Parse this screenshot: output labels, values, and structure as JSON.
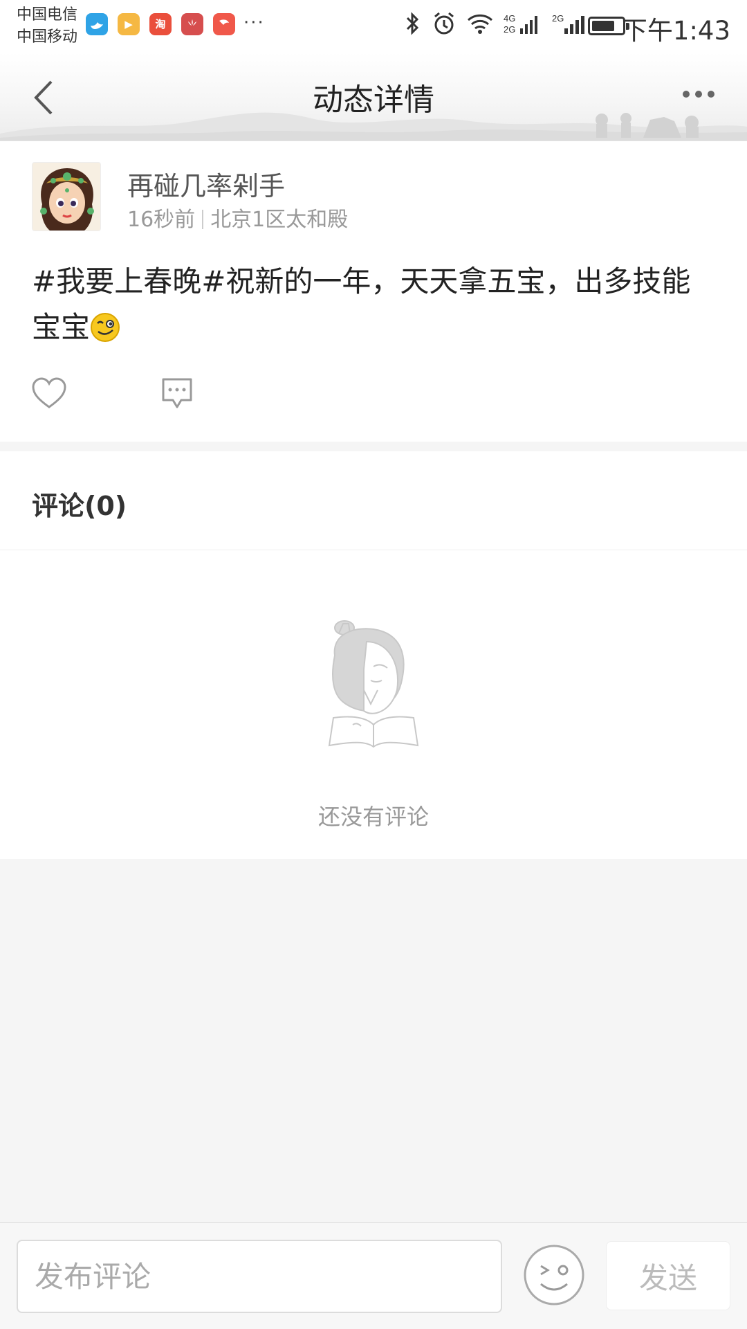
{
  "status_bar": {
    "carrier_1": "中国电信",
    "carrier_2": "中国移动",
    "notification_icons": [
      {
        "name": "bird-app-icon",
        "label": "",
        "color": "#2fa3e6"
      },
      {
        "name": "play-app-icon",
        "label": "▶",
        "color": "#f5b843"
      },
      {
        "name": "taobao-app-icon",
        "label": "淘",
        "color": "#ea4f3c"
      },
      {
        "name": "huawei-app-icon",
        "label": "",
        "color": "#d64e4e"
      },
      {
        "name": "shrimp-app-icon",
        "label": "",
        "color": "#f0584a"
      }
    ],
    "more_indicator": "···",
    "network_1": "4G 2G",
    "network_2": "2G",
    "battery_level": 0.74,
    "time": "下午1:43"
  },
  "header": {
    "title": "动态详情"
  },
  "post": {
    "username": "再碰几率剁手",
    "time_ago": "16秒前",
    "location": "北京1区太和殿",
    "text": "#我要上春晚#祝新的一年，天天拿五宝，出多技能宝宝",
    "emoji": "grinning-wink-emoji"
  },
  "comments": {
    "title": "评论(0)",
    "empty_text": "还没有评论"
  },
  "composer": {
    "placeholder": "发布评论",
    "value": "",
    "send_label": "发送"
  },
  "colors": {
    "accent_text": "#222222",
    "muted_text": "#999999",
    "background": "#f5f5f5"
  }
}
